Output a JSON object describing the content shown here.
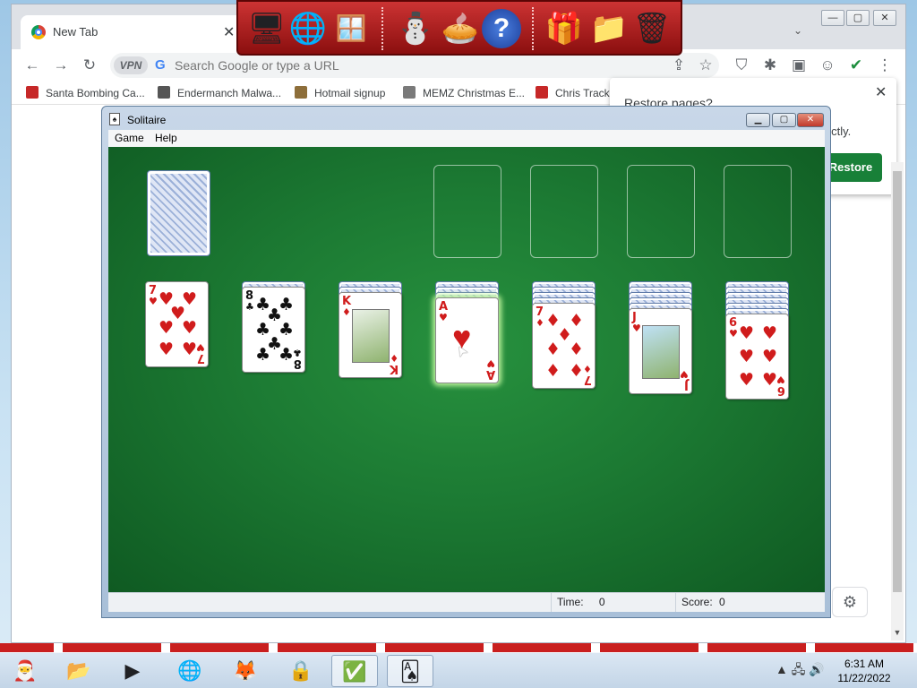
{
  "browser": {
    "tab_title": "New Tab",
    "tab_close": "✕",
    "omnibox_placeholder": "Search Google or type a URL",
    "vpn_label": "VPN",
    "g_letter": "G",
    "bookmarks": [
      {
        "label": "Santa Bombing Ca...",
        "icon": "santa-icon",
        "color": "#c62828"
      },
      {
        "label": "Endermanch Malwa...",
        "icon": "raccoon-icon",
        "color": "#555555"
      },
      {
        "label": "Hotmail signup",
        "icon": "person-icon",
        "color": "#8d6e3a"
      },
      {
        "label": "MEMZ Christmas E...",
        "icon": "cat-icon",
        "color": "#7a7a7a"
      },
      {
        "label": "Chris Tracke",
        "icon": "star-icon",
        "color": "#c62828"
      }
    ],
    "restore": {
      "title": "Restore pages?",
      "message": "orrectly.",
      "button": "Restore",
      "close": "✕"
    }
  },
  "solitaire": {
    "title": "Solitaire",
    "menu": [
      "Game",
      "Help"
    ],
    "status": {
      "time_label": "Time:",
      "time_value": "0",
      "score_label": "Score:",
      "score_value": "0"
    },
    "tableau": [
      {
        "rank": "7",
        "suit": "♥",
        "color": "red",
        "hidden": 0
      },
      {
        "rank": "8",
        "suit": "♣",
        "color": "blk",
        "hidden": 1
      },
      {
        "rank": "K",
        "suit": "♦",
        "color": "red",
        "hidden": 2
      },
      {
        "rank": "A",
        "suit": "♥",
        "color": "red",
        "hidden": 3
      },
      {
        "rank": "7",
        "suit": "♦",
        "color": "red",
        "hidden": 4
      },
      {
        "rank": "J",
        "suit": "♥",
        "color": "red",
        "hidden": 5
      },
      {
        "rank": "6",
        "suit": "♥",
        "color": "red",
        "hidden": 6
      }
    ],
    "foundations": 4,
    "felt_color": "#1c7a33"
  },
  "taskbar": {
    "time": "6:31 AM",
    "date": "11/22/2022",
    "tray": "▲ 🖧 🔊"
  }
}
